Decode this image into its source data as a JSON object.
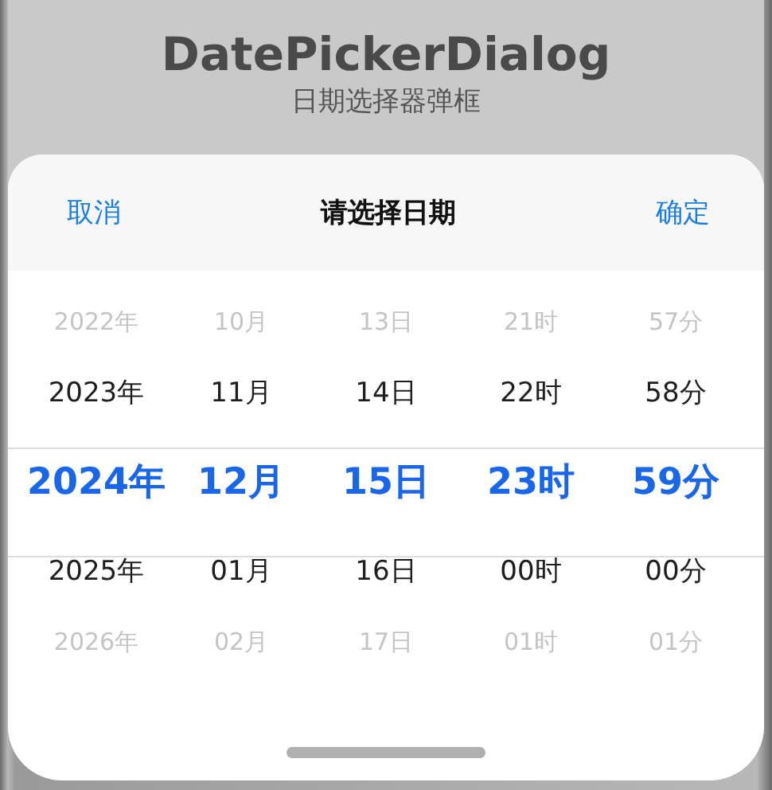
{
  "page": {
    "title": "DatePickerDialog",
    "subtitle": "日期选择器弹框"
  },
  "dialog": {
    "cancel": "取消",
    "title": "请选择日期",
    "confirm": "确定",
    "columns": [
      {
        "items": [
          {
            "text": "2022年",
            "selected": false,
            "faded": true
          },
          {
            "text": "2023年",
            "selected": false,
            "faded": false
          },
          {
            "text": "2024年",
            "selected": true,
            "faded": false
          },
          {
            "text": "2025年",
            "selected": false,
            "faded": false
          },
          {
            "text": "2026年",
            "selected": false,
            "faded": true
          }
        ]
      },
      {
        "items": [
          {
            "text": "10月",
            "selected": false,
            "faded": true
          },
          {
            "text": "11月",
            "selected": false,
            "faded": false
          },
          {
            "text": "12月",
            "selected": true,
            "faded": false
          },
          {
            "text": "01月",
            "selected": false,
            "faded": false
          },
          {
            "text": "02月",
            "selected": false,
            "faded": true
          }
        ]
      },
      {
        "items": [
          {
            "text": "13日",
            "selected": false,
            "faded": true
          },
          {
            "text": "14日",
            "selected": false,
            "faded": false
          },
          {
            "text": "15日",
            "selected": true,
            "faded": false
          },
          {
            "text": "16日",
            "selected": false,
            "faded": false
          },
          {
            "text": "17日",
            "selected": false,
            "faded": true
          }
        ]
      },
      {
        "items": [
          {
            "text": "21时",
            "selected": false,
            "faded": true
          },
          {
            "text": "22时",
            "selected": false,
            "faded": false
          },
          {
            "text": "23时",
            "selected": true,
            "faded": false
          },
          {
            "text": "00时",
            "selected": false,
            "faded": false
          },
          {
            "text": "01时",
            "selected": false,
            "faded": true
          }
        ]
      },
      {
        "items": [
          {
            "text": "57分",
            "selected": false,
            "faded": true
          },
          {
            "text": "58分",
            "selected": false,
            "faded": false
          },
          {
            "text": "59分",
            "selected": true,
            "faded": false
          },
          {
            "text": "00分",
            "selected": false,
            "faded": false
          },
          {
            "text": "01分",
            "selected": false,
            "faded": true
          }
        ]
      }
    ]
  }
}
